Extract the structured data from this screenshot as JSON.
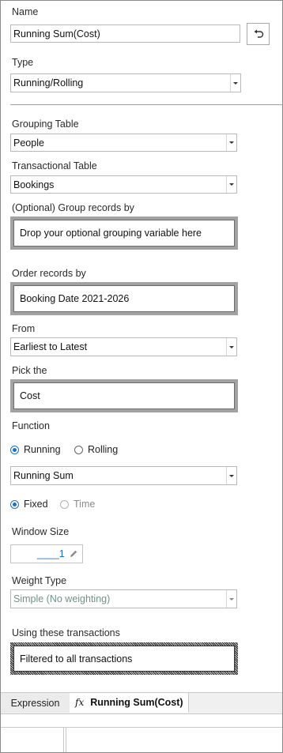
{
  "name": {
    "label": "Name",
    "value": "Running Sum(Cost)",
    "undo_icon": "undo-arrow-icon"
  },
  "type": {
    "label": "Type",
    "value": "Running/Rolling"
  },
  "grouping_table": {
    "label": "Grouping Table",
    "value": "People"
  },
  "transactional_table": {
    "label": "Transactional Table",
    "value": "Bookings"
  },
  "group_records": {
    "label": "(Optional) Group records by",
    "value": "Drop your optional grouping variable here"
  },
  "order_records": {
    "label": "Order records by",
    "value": "Booking Date 2021-2026"
  },
  "from": {
    "label": "From",
    "value": "Earliest to Latest"
  },
  "pick": {
    "label": "Pick the",
    "value": "Cost"
  },
  "function": {
    "label": "Function",
    "mode_options": [
      {
        "label": "Running",
        "selected": true
      },
      {
        "label": "Rolling",
        "selected": false
      }
    ],
    "value": "Running Sum",
    "window_options": [
      {
        "label": "Fixed",
        "selected": true
      },
      {
        "label": "Time",
        "selected": false,
        "disabled": true
      }
    ]
  },
  "window_size": {
    "label": "Window Size",
    "value": "____1",
    "edit_icon": "pencil-icon"
  },
  "weight_type": {
    "label": "Weight Type",
    "value": "Simple (No weighting)"
  },
  "transactions": {
    "label": "Using these transactions",
    "value": "Filtered to all transactions"
  },
  "tabs": [
    {
      "label": "Expression"
    },
    {
      "icon": "fx",
      "label": "Running Sum(Cost)"
    }
  ],
  "colors": {
    "accent": "#1d6fc2",
    "border": "#b9b9b9",
    "drop_border": "#a2a2a2"
  }
}
